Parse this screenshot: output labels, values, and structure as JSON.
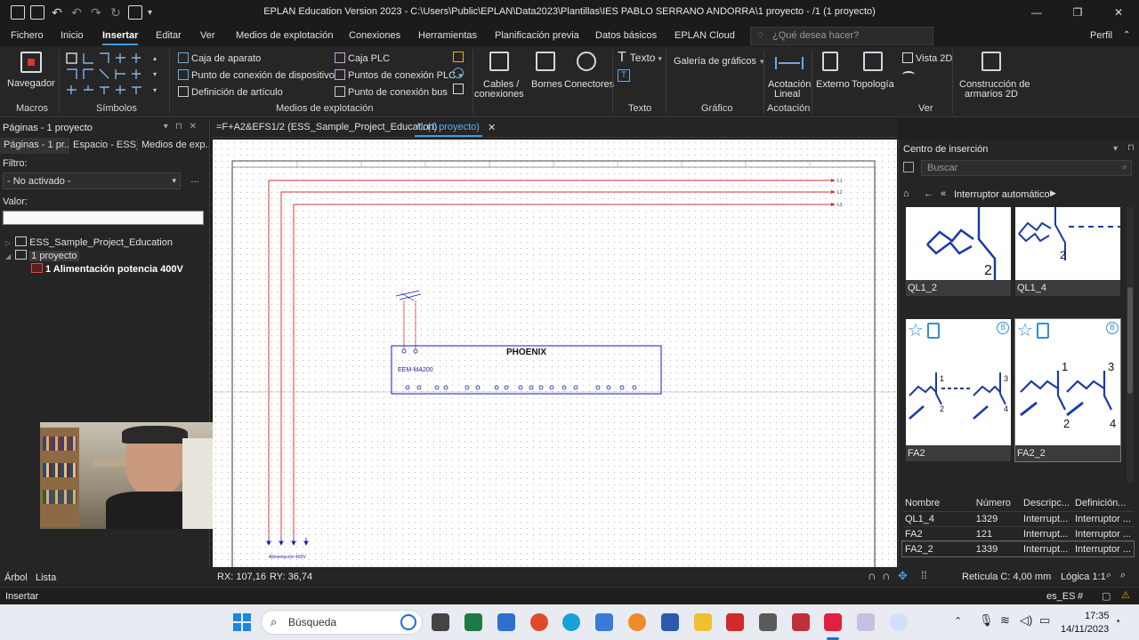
{
  "window": {
    "title": "EPLAN Education Version 2023 - C:\\Users\\Public\\EPLAN\\Data2023\\Plantillas\\IES PABLO SERRANO ANDORRA\\1 proyecto - /1 (1 proyecto)",
    "profile_label": "Perfil"
  },
  "menu": {
    "items": [
      "Fichero",
      "Inicio",
      "Insertar",
      "Editar",
      "Ver",
      "Medios de explotación",
      "Conexiones",
      "Herramientas",
      "Planificación previa",
      "Datos básicos",
      "EPLAN Cloud"
    ],
    "active": "Insertar",
    "search_placeholder": "¿Qué desea hacer?"
  },
  "ribbon": {
    "navegador": "Navegador",
    "group_macros": "Macros",
    "group_simbolos": "Símbolos",
    "group_medios": "Medios de explotación",
    "group_texto": "Texto",
    "group_grafico": "Gráfico",
    "group_acotacion": "Acotación",
    "group_ver": "Ver",
    "caja_aparato": "Caja de aparato",
    "punto_conexion_dispositivo": "Punto de conexión de dispositivo",
    "definicion_articulo": "Definición de artículo",
    "caja_plc": "Caja PLC",
    "puntos_conexion_plc": "Puntos de conexión PLC",
    "punto_conexion_bus": "Punto de conexión bus",
    "cables_conexiones_1": "Cables /",
    "cables_conexiones_2": "conexiones",
    "bornes": "Bornes",
    "conectores": "Conectores",
    "texto": "Texto",
    "galeria_graficos": "Galería de gráficos",
    "acotacion_lineal_1": "Acotación",
    "acotacion_lineal_2": "Lineal",
    "externo": "Externo",
    "topologia": "Topología",
    "vista_2d": "Vista 2D",
    "construccion_1": "Construcción de",
    "construccion_2": "armarios 2D"
  },
  "left_panel": {
    "title": "Páginas - 1 proyecto",
    "tabs": [
      "Páginas - 1 pr...",
      "Espacio - ESS_...",
      "Medios de exp..."
    ],
    "filtro_label": "Filtro:",
    "filtro_value": "- No activado -",
    "valor_label": "Valor:",
    "tree": [
      "ESS_Sample_Project_Education",
      "1 proyecto",
      "1 Alimentación potencia 400V"
    ],
    "bottom_tabs": [
      "Árbol",
      "Lista"
    ]
  },
  "doc_tabs": [
    "=F+A2&EFS1/2 (ESS_Sample_Project_Education)",
    "/1 (1 proyecto)"
  ],
  "schematic": {
    "phase_labels": [
      "L1",
      "L2",
      "L3"
    ],
    "device_name": "EEM-MA200",
    "device_logo": "PHOENIX",
    "feed_label": "Alimentación 400V"
  },
  "status": {
    "rx": "RX: 107,16",
    "ry": "RY: 36,74",
    "grid": "Retícula C: 4,00 mm",
    "logic": "Lógica 1:1",
    "mode": "Insertar",
    "lang": "es_ES",
    "hash": "#"
  },
  "insert_center": {
    "title": "Centro de inserción",
    "search_placeholder": "Buscar",
    "breadcrumb": "Interruptor automático",
    "symbols": [
      {
        "name": "QL1_2",
        "badge": ""
      },
      {
        "name": "QL1_4",
        "badge": ""
      },
      {
        "name": "FA2",
        "badge": "8"
      },
      {
        "name": "FA2_2",
        "badge": "8"
      }
    ],
    "table": {
      "headers": [
        "Nombre",
        "Número",
        "Descripc...",
        "Definición..."
      ],
      "rows": [
        [
          "QL1_4",
          "1329",
          "Interrupt...",
          "Interruptor ..."
        ],
        [
          "FA2",
          "121",
          "Interrupt...",
          "Interruptor ..."
        ],
        [
          "FA2_2",
          "1339",
          "Interrupt...",
          "Interruptor ..."
        ]
      ]
    }
  },
  "taskbar": {
    "search": "Búsqueda",
    "time": "17:35",
    "date": "14/11/2023"
  },
  "colors": {
    "accent": "#3aa0e6",
    "schematic_blue": "#1a1aa8",
    "phase_red": "#d43a3a"
  }
}
